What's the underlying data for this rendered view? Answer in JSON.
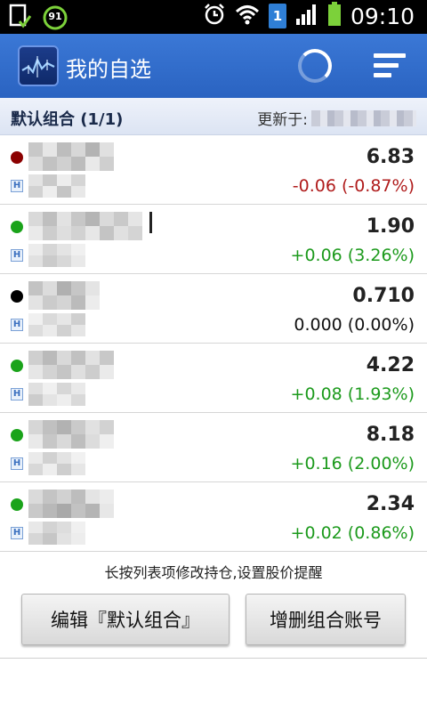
{
  "status_bar": {
    "battery_percent": "91",
    "sim_badge": "1",
    "time": "09:10",
    "icons": [
      "sim-check-icon",
      "battery-circle-icon",
      "alarm-icon",
      "wifi-icon",
      "sim-badge-icon",
      "signal-icon",
      "battery-icon"
    ]
  },
  "app_bar": {
    "title": "我的自选",
    "icons": [
      "app-logo-icon",
      "loading-spinner-icon",
      "sort-menu-icon"
    ]
  },
  "section": {
    "title": "默认组合 (1/1)",
    "updated_label": "更新于:"
  },
  "stocks": [
    {
      "dot_color": "#8b0000",
      "price": "6.83",
      "change": "-0.06 (-0.87%)",
      "change_color": "#b01c1c"
    },
    {
      "dot_color": "#1aa31a",
      "price": "1.90",
      "change": "+0.06 (3.26%)",
      "change_color": "#1c9a1c"
    },
    {
      "dot_color": "#000000",
      "price": "0.710",
      "change": "0.000 (0.00%)",
      "change_color": "#111111"
    },
    {
      "dot_color": "#1aa31a",
      "price": "4.22",
      "change": "+0.08 (1.93%)",
      "change_color": "#1c9a1c"
    },
    {
      "dot_color": "#1aa31a",
      "price": "8.18",
      "change": "+0.16 (2.00%)",
      "change_color": "#1c9a1c"
    },
    {
      "dot_color": "#1aa31a",
      "price": "2.34",
      "change": "+0.02 (0.86%)",
      "change_color": "#1c9a1c"
    }
  ],
  "market_badge": "H",
  "footer": {
    "hint": "长按列表项修改持仓,设置股价提醒",
    "edit_button": "编辑『默认组合』",
    "account_button": "增删组合账号"
  }
}
